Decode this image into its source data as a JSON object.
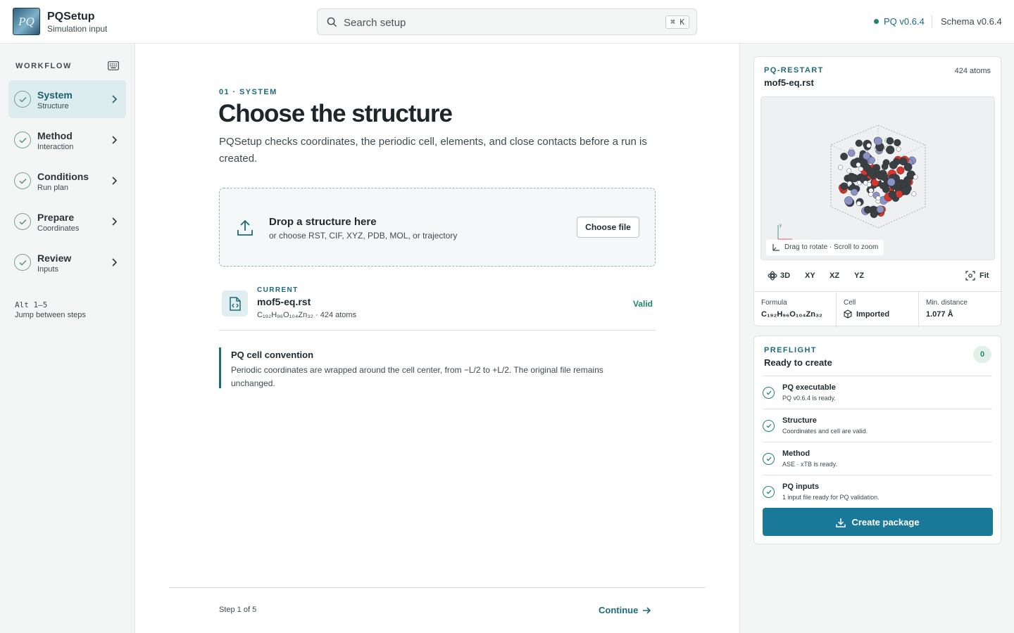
{
  "app": {
    "logo": "PQ",
    "name": "PQSetup",
    "subtitle": "Simulation input"
  },
  "search": {
    "placeholder": "Search setup",
    "shortcut": "⌘ K"
  },
  "versions": {
    "pq": "PQ v0.6.4",
    "schema": "Schema v0.6.4"
  },
  "sidebar": {
    "heading": "WORKFLOW",
    "steps": [
      {
        "title": "System",
        "sub": "Structure"
      },
      {
        "title": "Method",
        "sub": "Interaction"
      },
      {
        "title": "Conditions",
        "sub": "Run plan"
      },
      {
        "title": "Prepare",
        "sub": "Coordinates"
      },
      {
        "title": "Review",
        "sub": "Inputs"
      }
    ],
    "hint_keys": "Alt 1–5",
    "hint_text": "Jump between steps"
  },
  "main": {
    "eyebrow": "01 · SYSTEM",
    "title": "Choose the structure",
    "lead": "PQSetup checks coordinates, the periodic cell, elements, and close contacts before a run is created.",
    "drop": {
      "title": "Drop a structure here",
      "sub": "or choose RST, CIF, XYZ, PDB, MOL, or trajectory",
      "button": "Choose file"
    },
    "current": {
      "label": "CURRENT",
      "name": "mof5-eq.rst",
      "formula": "C₁₉₂H₉₆O₁₀₄Zn₃₂ · 424 atoms",
      "status": "Valid"
    },
    "note": {
      "title": "PQ cell convention",
      "body": "Periodic coordinates are wrapped around the cell center, from −L/2 to +L/2. The original file remains unchanged."
    },
    "footer": {
      "step": "Step 1 of 5",
      "continue": "Continue"
    }
  },
  "preview": {
    "label": "PQ-RESTART",
    "atoms": "424 atoms",
    "name": "mof5-eq.rst",
    "drag_hint": "Drag to rotate · Scroll to zoom",
    "views": [
      "3D",
      "XY",
      "XZ",
      "YZ"
    ],
    "fit": "Fit",
    "stats": [
      {
        "k": "Formula",
        "v": "C₁₉₂H₉₆O₁₀₄Zn₃₂"
      },
      {
        "k": "Cell",
        "v": "Imported"
      },
      {
        "k": "Min. distance",
        "v": "1.077 Å"
      }
    ]
  },
  "preflight": {
    "label": "PREFLIGHT",
    "title": "Ready to create",
    "count": "0",
    "checks": [
      {
        "t": "PQ executable",
        "s": "PQ v0.6.4 is ready."
      },
      {
        "t": "Structure",
        "s": "Coordinates and cell are valid."
      },
      {
        "t": "Method",
        "s": "ASE · xTB is ready."
      },
      {
        "t": "PQ inputs",
        "s": "1 input file ready for PQ validation."
      }
    ],
    "button": "Create package"
  },
  "colors": {
    "accent": "#1d6b78",
    "primary_button": "#1a7898",
    "success": "#21856b",
    "carbon": "#3a3f44",
    "oxygen": "#d9352b",
    "zinc": "#8a93c4",
    "hydrogen": "#ffffff"
  }
}
